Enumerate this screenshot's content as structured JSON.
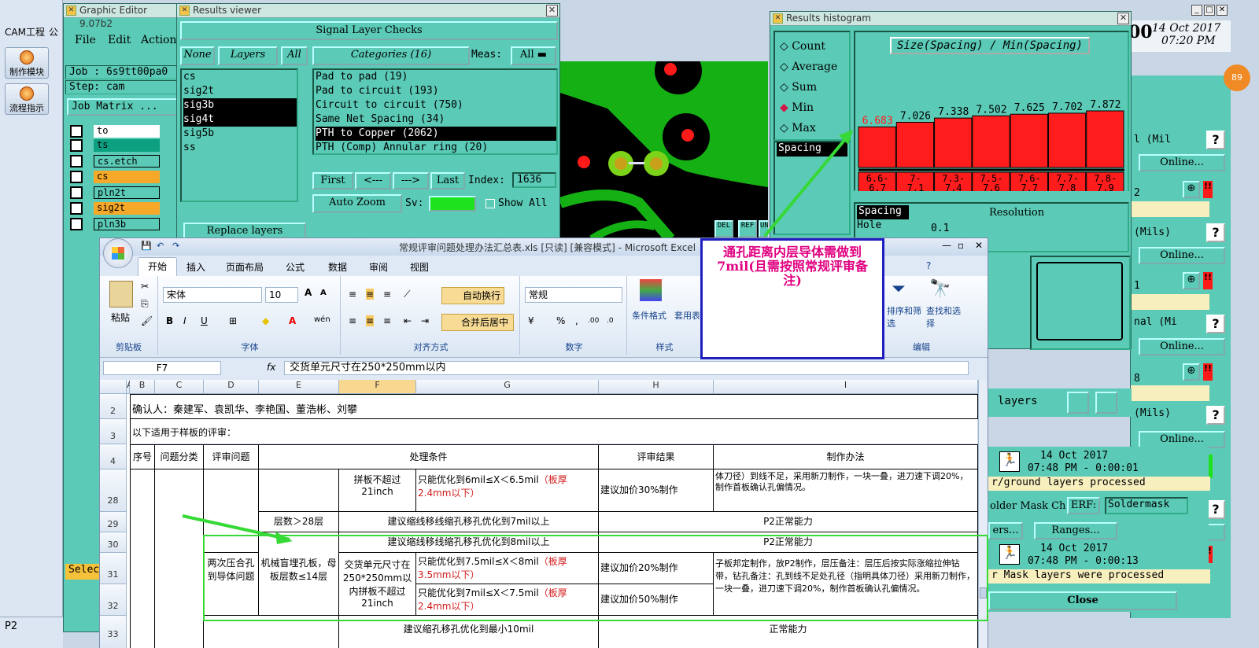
{
  "taskbar": {
    "menu": "CAM工程",
    "menu2": "公",
    "btn1": "制作模块",
    "btn2": "流程指示",
    "bottom_left": "P2",
    "bottom_right": "局"
  },
  "graphic_editor": {
    "title": "Graphic Editor 9.07b2",
    "menu": [
      "File",
      "Edit",
      "Actions"
    ],
    "job": "Job : 6s9tt00pa0",
    "step": "Step: cam",
    "job_matrix": "Job Matrix ...",
    "layers": [
      "to",
      "ts",
      "cs.etch",
      "cs",
      "pln2t",
      "sig2t",
      "pln3b"
    ],
    "select": "Select"
  },
  "results_viewer": {
    "title": "Results viewer",
    "header": "Signal Layer Checks",
    "none_btn": "None",
    "layers_btn": "Layers",
    "all_btn": "All",
    "categories_btn": "Categories (16)",
    "meas_label": "Meas:",
    "meas_value": "All",
    "layer_list": [
      "cs",
      "sig2t",
      "sig3b",
      "sig4t",
      "sig5b",
      "ss"
    ],
    "categories": [
      "Pad to pad (19)",
      "Pad to circuit (193)",
      "Circuit to circuit (750)",
      "Same Net Spacing (34)",
      "PTH to Copper (2062)",
      "PTH (Comp) Annular ring (20)"
    ],
    "first": "First",
    "prev": "<---",
    "next": "--->",
    "last": "Last",
    "index_label": "Index:",
    "index_value": "1636",
    "auto_zoom": "Auto Zoom",
    "sv_label": "Sv:",
    "show_all": "Show All",
    "replace_layers": "Replace layers",
    "del": "DEL",
    "ref": "REF",
    "undo": "UNDO"
  },
  "histogram": {
    "title": "Results histogram",
    "options": [
      "Count",
      "Average",
      "Sum",
      "Min",
      "Max"
    ],
    "selected_option": "Min",
    "spacing_label": "Spacing",
    "chart_title": "Size(Spacing) / Min(Spacing)",
    "spacing_tag": "Spacing",
    "hole_tag": "Hole",
    "resolution_label": "Resolution",
    "resolution_value": "0.1"
  },
  "chart_data": {
    "type": "bar",
    "title": "Size(Spacing) / Min(Spacing)",
    "categories": [
      "6.6-6.7",
      "7-7.1",
      "7.3-7.4",
      "7.5-7.6",
      "7.6-7.7",
      "7.7-7.8",
      "7.8-7.9"
    ],
    "values": [
      6.683,
      7.026,
      7.338,
      7.502,
      7.625,
      7.702,
      7.872
    ],
    "color": "#ff1c1c"
  },
  "clock": {
    "date": "14 Oct 2017",
    "time": "07:20 PM",
    "digit": "00"
  },
  "right_panel": {
    "rows": [
      {
        "label": "l (Mil",
        "online": "Online..."
      },
      {
        "label": "2",
        "online": "Online..."
      },
      {
        "label": "(Mils)",
        "online": "Online..."
      },
      {
        "label": "1",
        "online": "Online..."
      },
      {
        "label": "nal (Mi",
        "online": "Online..."
      },
      {
        "label": "8",
        "online": "Online..."
      },
      {
        "label": "(Mils)",
        "online": "Online..."
      }
    ],
    "layers_lbl": "layers",
    "log1_date": "14 Oct 2017",
    "log1_time": "07:48 PM - 0:00:01",
    "log1_msg": "r/ground layers processed",
    "solder_label": "older Mask Ch",
    "erf": "ERF:",
    "soldermask": "Soldermask",
    "ers": "ers...",
    "ranges": "Ranges...",
    "online": "Online...",
    "log2_date": "14 Oct 2017",
    "log2_time": "07:48 PM - 0:00:13",
    "log2_msg": "r Mask layers were processed",
    "close": "Close",
    "badge": "89"
  },
  "note": {
    "text": "通孔距离内层导体需做到7mil(且需按照常规评审备注)"
  },
  "excel": {
    "title": "常规评审问题处理办法汇总表.xls [只读] [兼容模式] - Microsoft Excel",
    "tabs": [
      "开始",
      "插入",
      "页面布局",
      "公式",
      "数据",
      "审阅",
      "视图"
    ],
    "font_name": "宋体",
    "font_size": "10",
    "wrap": "自动换行",
    "merge": "合并后居中",
    "number_format": "常规",
    "paste": "粘贴",
    "clipboard": "剪贴板",
    "font_group": "字体",
    "align_group": "对齐方式",
    "number_group": "数字",
    "style_group": "样式",
    "edit_group": "编辑",
    "cond_format": "条件格式",
    "table_format": "套用表格格式",
    "sort": "排序和筛选",
    "find": "查找和选择",
    "name_box": "F7",
    "fx": "fx",
    "formula": "交货单元尺寸在250*250mm以内",
    "cols": [
      "A",
      "B",
      "C",
      "D",
      "E",
      "F",
      "G",
      "H",
      "I"
    ],
    "rows": {
      "r2": "确认人：秦建军、袁凯华、李艳国、董浩彬、刘攀",
      "r3": "以下适用于样板的评审：",
      "r4": [
        "序号",
        "问题分类",
        "评审问题",
        "处理条件",
        "评审结果",
        "制作办法"
      ],
      "r28": {
        "f": "拼板不超过21inch",
        "g1": "只能优化到6mil≤X＜6.5mil",
        "g2": "（板厚2.4mm以下）",
        "h": "建议加价30%制作",
        "i": "体刀径）到线不足，采用新刀制作，一块一叠，进刀速下调20%，制作首板确认孔偏情况。"
      },
      "r29": {
        "e": "层数＞28层",
        "fg": "建议缩线移线缩孔移孔优化到7mil以上",
        "hi": "P2正常能力"
      },
      "r30": {
        "fg": "建议缩线移线缩孔移孔优化到8mil以上",
        "hi": "P2正常能力"
      },
      "r31": {
        "d": "两次压合孔到导体问题",
        "e": "机械盲埋孔板，母板层数≤14层",
        "f": "交货单元尺寸在250*250mm以内拼板不超过21inch",
        "g1": "只能优化到7.5mil≤X＜8mil",
        "g2": "（板厚3.5mm以下）",
        "h": "建议加价20%制作",
        "i": "子板邦定制作，放P2制作，层压备注：层压后按实际涨缩拉伸钻带，钻孔备注：孔到线不足处孔径（指明具体刀径）采用新刀制作，一块一叠，进刀速下调20%，制作首板确认孔偏情况。"
      },
      "r32": {
        "g1": "只能优化到7mil≤X＜7.5mil",
        "g2": "（板厚2.4mm以下）",
        "h": "建议加价50%制作"
      },
      "r33": {
        "fg": "建议缩孔移孔优化到最小10mil",
        "hi": "正常能力"
      }
    },
    "row_numbers": [
      "2",
      "3",
      "4",
      "28",
      "29",
      "30",
      "31",
      "32",
      "33"
    ]
  }
}
